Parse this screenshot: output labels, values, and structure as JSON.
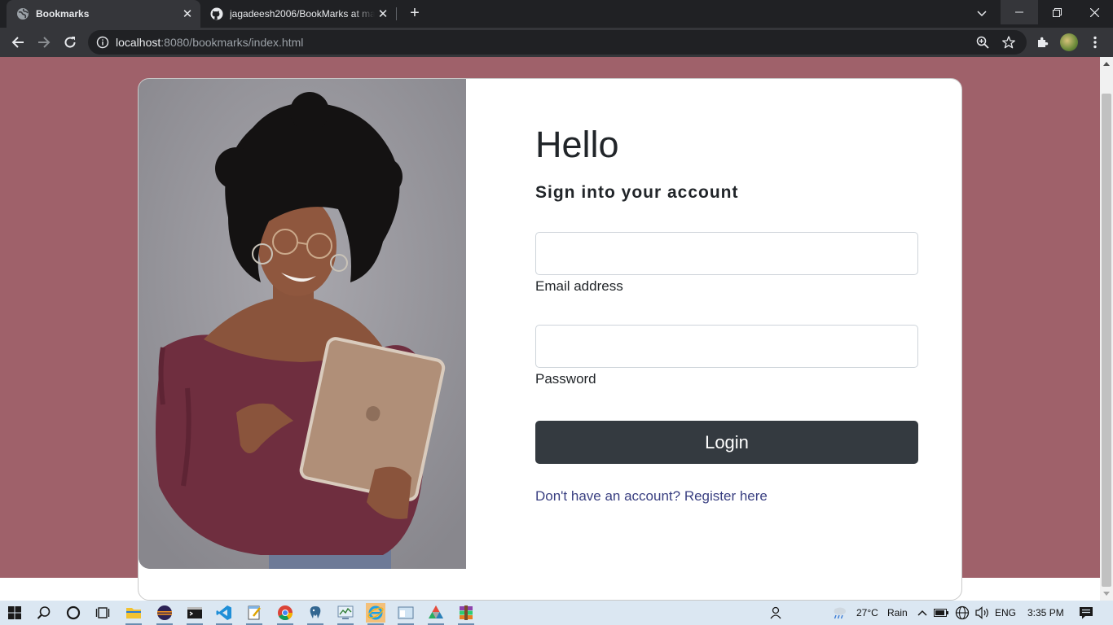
{
  "browser": {
    "tabs": [
      {
        "title": "Bookmarks",
        "active": true,
        "favicon": "globe-icon"
      },
      {
        "title": "jagadeesh2006/BookMarks at main",
        "active": false,
        "favicon": "github-icon"
      }
    ],
    "url_host": "localhost",
    "url_rest": ":8080/bookmarks/index.html"
  },
  "login": {
    "heading": "Hello",
    "subtitle": "Sign into your account",
    "email_label": "Email address",
    "email_value": "",
    "password_label": "Password",
    "password_value": "",
    "login_button": "Login",
    "register_link": "Don't have an account? Register here"
  },
  "colors": {
    "page_background": "#9f616a",
    "button": "#343a40",
    "link": "#393f81"
  },
  "taskbar": {
    "weather_temp": "27°C",
    "weather_text": "Rain",
    "language": "ENG",
    "time": "3:35 PM"
  }
}
